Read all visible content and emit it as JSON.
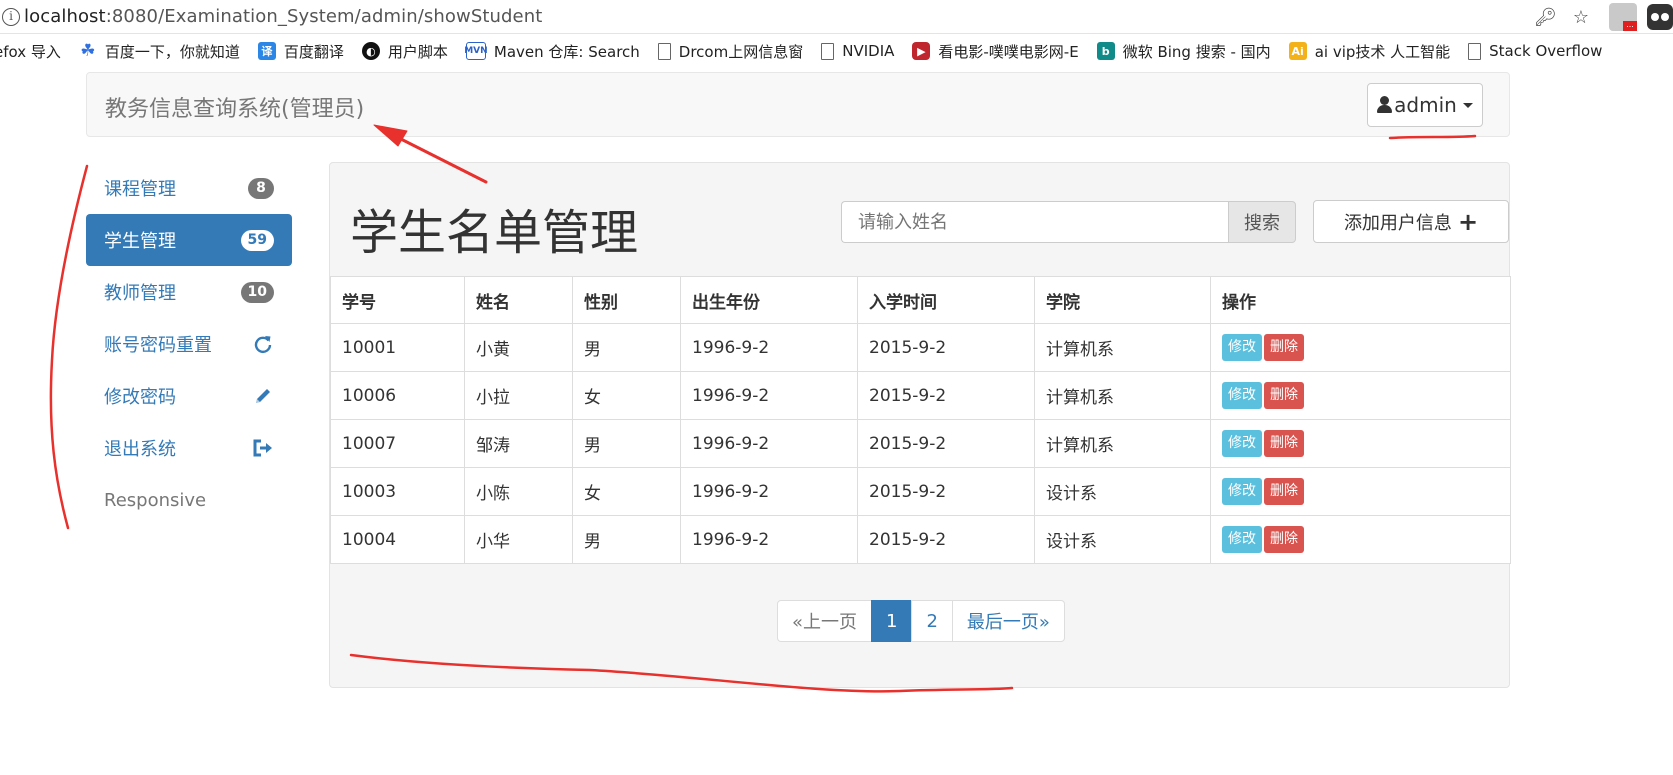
{
  "browser": {
    "url_host": "localhost",
    "url_path": ":8080/Examination_System/admin/showStudent",
    "bookmarks": [
      {
        "label": "efox 导入",
        "icon": "none"
      },
      {
        "label": "百度一下，你就知道",
        "icon": "baidu-paw-icon"
      },
      {
        "label": "百度翻译",
        "icon": "baidu-translate-icon"
      },
      {
        "label": "用户脚本",
        "icon": "userscript-icon"
      },
      {
        "label": "Maven 仓库: Search",
        "icon": "maven-icon"
      },
      {
        "label": "Drcom上网信息窗",
        "icon": "page-icon"
      },
      {
        "label": "NVIDIA",
        "icon": "page-icon"
      },
      {
        "label": "看电影-噗噗电影网-E",
        "icon": "movie-icon"
      },
      {
        "label": "微软 Bing 搜索 - 国内",
        "icon": "bing-icon"
      },
      {
        "label": "ai vip技术 人工智能 ",
        "icon": "ai-icon"
      },
      {
        "label": "Stack Overflow",
        "icon": "page-icon"
      }
    ],
    "ext_badge": "..."
  },
  "navbar": {
    "brand": "教务信息查询系统(管理员)",
    "user": "admin"
  },
  "sidebar": {
    "items": [
      {
        "label": "课程管理",
        "badge": "8",
        "icon": "badge"
      },
      {
        "label": "学生管理",
        "badge": "59",
        "icon": "badge",
        "active": true
      },
      {
        "label": "教师管理",
        "badge": "10",
        "icon": "badge"
      },
      {
        "label": "账号密码重置",
        "icon": "refresh-icon"
      },
      {
        "label": "修改密码",
        "icon": "pencil-icon"
      },
      {
        "label": "退出系统",
        "icon": "logout-icon"
      },
      {
        "label": "Responsive",
        "icon": "none"
      }
    ]
  },
  "main": {
    "title": "学生名单管理",
    "search_placeholder": "请输入姓名",
    "search_button": "搜索",
    "add_button": "添加用户信息",
    "table": {
      "headers": [
        "学号",
        "姓名",
        "性别",
        "出生年份",
        "入学时间",
        "学院",
        "操作"
      ],
      "rows": [
        [
          "10001",
          "小黄",
          "男",
          "1996-9-2",
          "2015-9-2",
          "计算机系"
        ],
        [
          "10006",
          "小拉",
          "女",
          "1996-9-2",
          "2015-9-2",
          "计算机系"
        ],
        [
          "10007",
          "邹涛",
          "男",
          "1996-9-2",
          "2015-9-2",
          "计算机系"
        ],
        [
          "10003",
          "小陈",
          "女",
          "1996-9-2",
          "2015-9-2",
          "设计系"
        ],
        [
          "10004",
          "小华",
          "男",
          "1996-9-2",
          "2015-9-2",
          "设计系"
        ]
      ],
      "edit_label": "修改",
      "delete_label": "删除"
    },
    "pagination": {
      "prev": "«上一页",
      "pages": [
        "1",
        "2"
      ],
      "current": "1",
      "last": "最后一页»"
    }
  },
  "colors": {
    "primary": "#337ab7",
    "info": "#5bc0de",
    "danger": "#d9534f",
    "annotation_red": "#e8302c"
  }
}
